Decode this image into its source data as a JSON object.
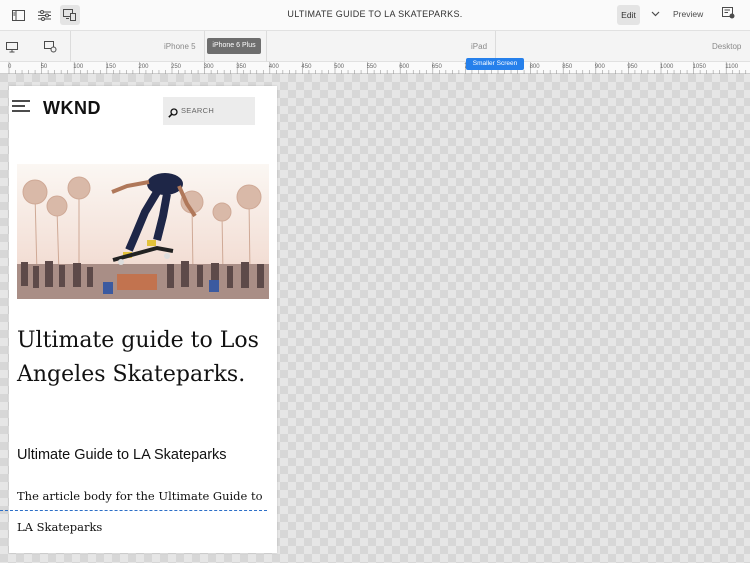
{
  "toolbar": {
    "title": "ULTIMATE GUIDE TO LA SKATEPARKS.",
    "edit_label": "Edit",
    "preview_label": "Preview",
    "icons": [
      "side-panel-icon",
      "properties-icon",
      "emulator-icon",
      "chevron-down-icon",
      "annotation-icon"
    ]
  },
  "devices": {
    "items": [
      {
        "label": "iPhone 5"
      },
      {
        "label": "iPhone 6 Plus"
      },
      {
        "label": "iPad"
      },
      {
        "label": "Desktop"
      }
    ],
    "badge": "Smaller Screen"
  },
  "ruler": {
    "ticks": [
      "0",
      "50",
      "100",
      "150",
      "200",
      "250",
      "300",
      "350",
      "400",
      "450",
      "500",
      "550",
      "600",
      "650",
      "700",
      "750",
      "800",
      "850",
      "900",
      "950",
      "1000",
      "1050",
      "1100"
    ]
  },
  "page": {
    "logo": "WKND",
    "search_placeholder": "SEARCH",
    "title": "Ultimate guide to Los Angeles Skateparks.",
    "subtitle": "Ultimate Guide to LA Skateparks",
    "body": "The article body for the Ultimate Guide to LA Skateparks"
  },
  "colors": {
    "accent": "#2680eb",
    "active_device": "#6e6e6e"
  }
}
